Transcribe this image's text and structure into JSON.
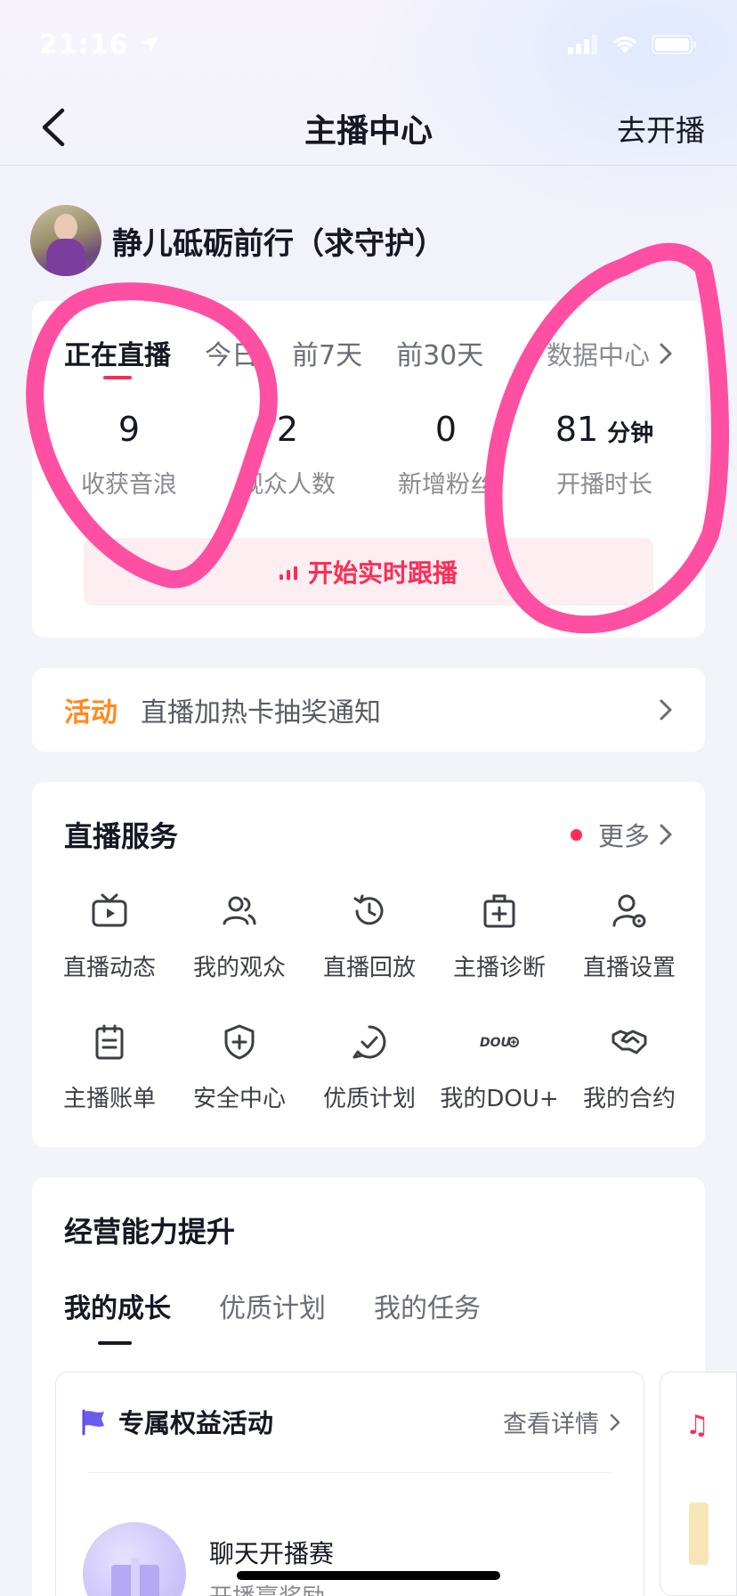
{
  "status_bar": {
    "time": "21:16"
  },
  "nav": {
    "title": "主播中心",
    "action": "去开播"
  },
  "profile": {
    "name": "静儿砥砺前行（求守护）"
  },
  "stats": {
    "tabs": [
      "正在直播",
      "今日",
      "前7天",
      "前30天"
    ],
    "active_tab": "正在直播",
    "data_center": "数据中心",
    "metrics": [
      {
        "value": "9",
        "unit": "",
        "label": "收获音浪"
      },
      {
        "value": "2",
        "unit": "",
        "label": "观众人数"
      },
      {
        "value": "0",
        "unit": "",
        "label": "新增粉丝"
      },
      {
        "value": "81",
        "unit": "分钟",
        "label": "开播时长"
      }
    ],
    "live_follow": "开始实时跟播"
  },
  "activity": {
    "tag": "活动",
    "text": "直播加热卡抽奖通知"
  },
  "services": {
    "title": "直播服务",
    "more": "更多",
    "items": [
      {
        "label": "直播动态",
        "icon": "tv-play-icon"
      },
      {
        "label": "我的观众",
        "icon": "users-icon"
      },
      {
        "label": "直播回放",
        "icon": "history-clock-icon"
      },
      {
        "label": "主播诊断",
        "icon": "medical-kit-icon"
      },
      {
        "label": "直播设置",
        "icon": "user-settings-icon"
      },
      {
        "label": "主播账单",
        "icon": "bill-icon"
      },
      {
        "label": "安全中心",
        "icon": "shield-plus-icon"
      },
      {
        "label": "优质计划",
        "icon": "check-circle-icon"
      },
      {
        "label": "我的DOU+",
        "icon": "dou-plus-icon"
      },
      {
        "label": "我的合约",
        "icon": "handshake-icon"
      }
    ]
  },
  "business": {
    "title": "经营能力提升",
    "tabs": [
      "我的成长",
      "优质计划",
      "我的任务"
    ],
    "active_tab": "我的成长",
    "card": {
      "title": "专属权益活动",
      "link": "查看详情",
      "task_title": "聊天开播赛",
      "task_sub": "开播赢奖励"
    }
  },
  "colors": {
    "accent": "#fe2c55",
    "activity": "#ff8a1e",
    "annotation": "#ff4fa3"
  }
}
